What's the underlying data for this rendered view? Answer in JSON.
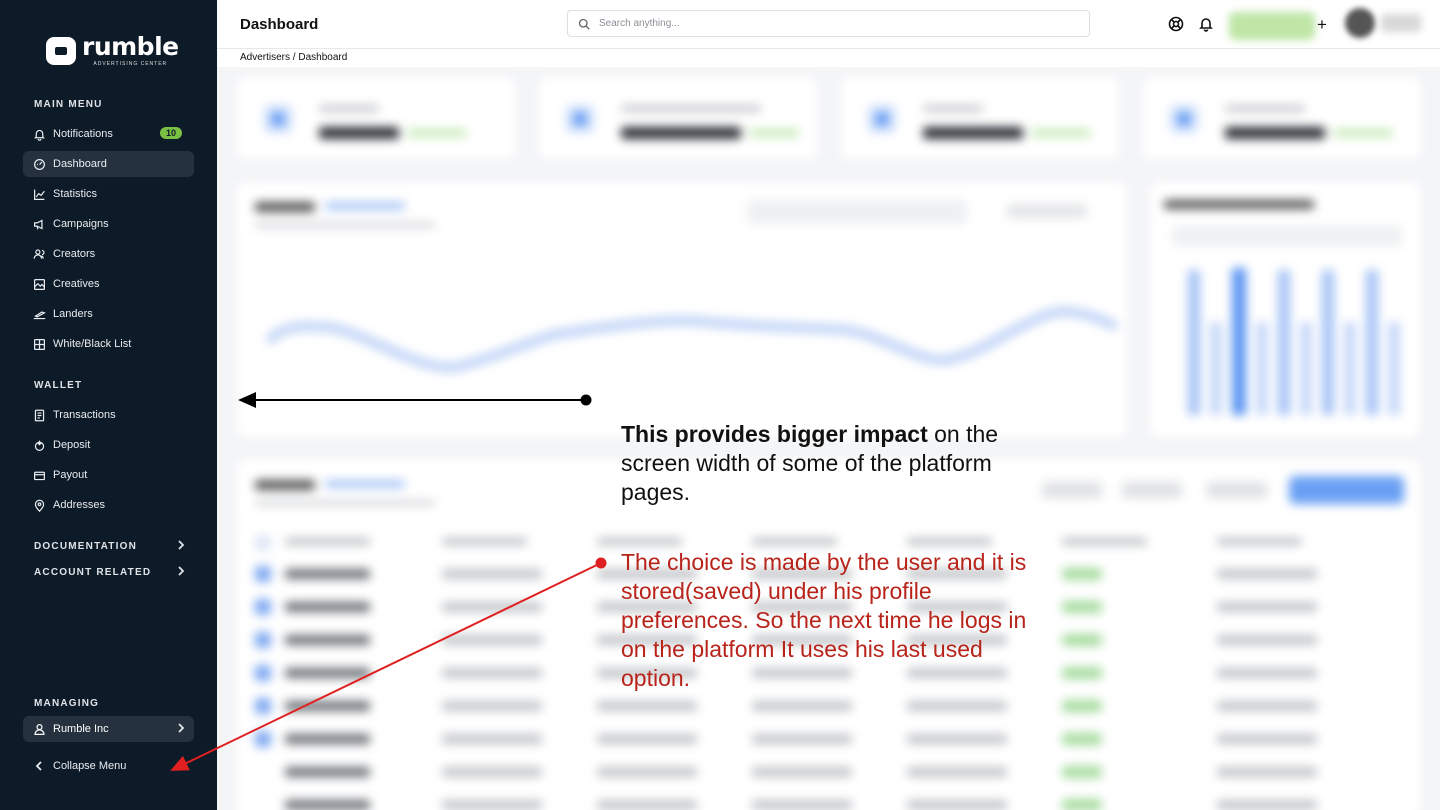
{
  "brand": {
    "name": "rumble",
    "subtitle": "ADVERTISING CENTER"
  },
  "sidebar": {
    "main_menu_title": "MAIN MENU",
    "items": [
      {
        "label": "Notifications",
        "icon": "bell-icon",
        "badge": "10"
      },
      {
        "label": "Dashboard",
        "icon": "dashboard-icon",
        "active": true
      },
      {
        "label": "Statistics",
        "icon": "chart-line-icon"
      },
      {
        "label": "Campaigns",
        "icon": "megaphone-icon"
      },
      {
        "label": "Creators",
        "icon": "users-icon"
      },
      {
        "label": "Creatives",
        "icon": "image-icon"
      },
      {
        "label": "Landers",
        "icon": "landing-icon"
      },
      {
        "label": "White/Black List",
        "icon": "list-icon"
      }
    ],
    "wallet_title": "WALLET",
    "wallet_items": [
      {
        "label": "Transactions",
        "icon": "receipt-icon"
      },
      {
        "label": "Deposit",
        "icon": "deposit-icon"
      },
      {
        "label": "Payout",
        "icon": "wallet-icon"
      },
      {
        "label": "Addresses",
        "icon": "location-pin-icon"
      }
    ],
    "documentation": "DOCUMENTATION",
    "account_related": "ACCOUNT RELATED",
    "managing_title": "MANAGING",
    "org": "Rumble Inc",
    "collapse": "Collapse Menu"
  },
  "header": {
    "title": "Dashboard",
    "search_placeholder": "Search anything...",
    "plus": "+"
  },
  "breadcrumb": "Advertisers / Dashboard",
  "annotations": {
    "impact_bold": "This provides bigger impact",
    "impact_rest": " on the screen width of some of the platform pages.",
    "choice": "The choice is made by the user and it is stored(saved) under his profile preferences. So the next time he logs in on the platform It uses his last used option."
  },
  "colors": {
    "sidebar_bg": "#0d1a27",
    "accent_green": "#7ac143",
    "annotation_red": "#b8231a",
    "chart_blue": "#5b95f2"
  }
}
